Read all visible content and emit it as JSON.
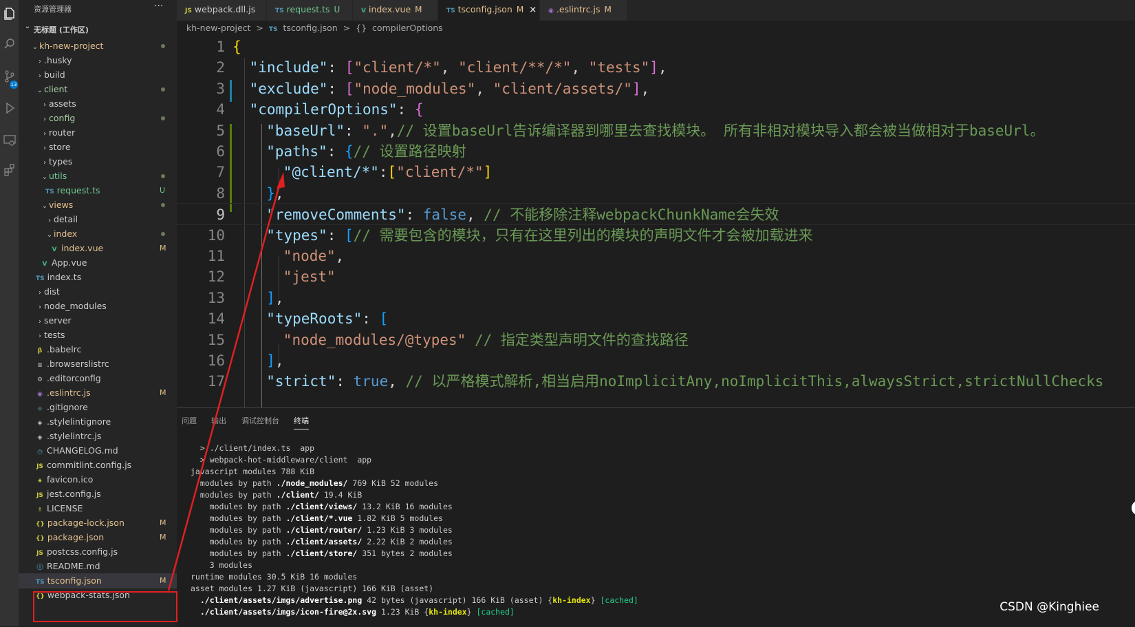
{
  "sidebar": {
    "header": "资源管理器",
    "more_label": "···",
    "workspace": "无标题 (工作区)",
    "items": [
      {
        "label": "kh-new-project",
        "depth": 0,
        "kind": "folder-open",
        "color": "#e2c08d",
        "status": "dot"
      },
      {
        "label": ".husky",
        "depth": 1,
        "kind": "folder",
        "color": "#cccccc",
        "status": ""
      },
      {
        "label": "build",
        "depth": 1,
        "kind": "folder",
        "color": "#cccccc",
        "status": ""
      },
      {
        "label": "client",
        "depth": 1,
        "kind": "folder-open",
        "color": "#a6cfa0",
        "status": "dot"
      },
      {
        "label": "assets",
        "depth": 2,
        "kind": "folder",
        "color": "#cccccc",
        "status": ""
      },
      {
        "label": "config",
        "depth": 2,
        "kind": "folder",
        "color": "#a6cfa0",
        "status": "dot"
      },
      {
        "label": "router",
        "depth": 2,
        "kind": "folder",
        "color": "#cccccc",
        "status": ""
      },
      {
        "label": "store",
        "depth": 2,
        "kind": "folder",
        "color": "#cccccc",
        "status": ""
      },
      {
        "label": "types",
        "depth": 2,
        "kind": "folder",
        "color": "#cccccc",
        "status": ""
      },
      {
        "label": "utils",
        "depth": 2,
        "kind": "folder-open",
        "color": "#73c991",
        "status": "dot"
      },
      {
        "label": "request.ts",
        "depth": 3,
        "kind": "ts",
        "color": "#73c991",
        "status": "U"
      },
      {
        "label": "views",
        "depth": 2,
        "kind": "folder-open",
        "color": "#e2c08d",
        "status": "dot"
      },
      {
        "label": "detail",
        "depth": 3,
        "kind": "folder",
        "color": "#cccccc",
        "status": ""
      },
      {
        "label": "index",
        "depth": 3,
        "kind": "folder-open",
        "color": "#e2c08d",
        "status": "dot"
      },
      {
        "label": "index.vue",
        "depth": 4,
        "kind": "vue",
        "color": "#e2c08d",
        "status": "M"
      },
      {
        "label": "App.vue",
        "depth": 2,
        "kind": "vue",
        "color": "#cccccc",
        "status": ""
      },
      {
        "label": "index.ts",
        "depth": 1,
        "kind": "ts",
        "color": "#cccccc",
        "status": ""
      },
      {
        "label": "dist",
        "depth": 1,
        "kind": "folder",
        "color": "#cccccc",
        "status": ""
      },
      {
        "label": "node_modules",
        "depth": 1,
        "kind": "folder",
        "color": "#cccccc",
        "status": ""
      },
      {
        "label": "server",
        "depth": 1,
        "kind": "folder",
        "color": "#cccccc",
        "status": ""
      },
      {
        "label": "tests",
        "depth": 1,
        "kind": "folder",
        "color": "#cccccc",
        "status": ""
      },
      {
        "label": ".babelrc",
        "depth": 1,
        "kind": "babel",
        "color": "#cccccc",
        "status": ""
      },
      {
        "label": ".browserslistrc",
        "depth": 1,
        "kind": "lines",
        "color": "#cccccc",
        "status": ""
      },
      {
        "label": ".editorconfig",
        "depth": 1,
        "kind": "gear",
        "color": "#cccccc",
        "status": ""
      },
      {
        "label": ".eslintrc.js",
        "depth": 1,
        "kind": "eslint",
        "color": "#e2c08d",
        "status": "M"
      },
      {
        "label": ".gitignore",
        "depth": 1,
        "kind": "git",
        "color": "#cccccc",
        "status": ""
      },
      {
        "label": ".stylelintignore",
        "depth": 1,
        "kind": "stylelint",
        "color": "#cccccc",
        "status": ""
      },
      {
        "label": ".stylelintrc.js",
        "depth": 1,
        "kind": "stylelint",
        "color": "#cccccc",
        "status": ""
      },
      {
        "label": "CHANGELOG.md",
        "depth": 1,
        "kind": "clock",
        "color": "#cccccc",
        "status": ""
      },
      {
        "label": "commitlint.config.js",
        "depth": 1,
        "kind": "js",
        "color": "#cccccc",
        "status": ""
      },
      {
        "label": "favicon.ico",
        "depth": 1,
        "kind": "star",
        "color": "#cccccc",
        "status": ""
      },
      {
        "label": "jest.config.js",
        "depth": 1,
        "kind": "js",
        "color": "#cccccc",
        "status": ""
      },
      {
        "label": "LICENSE",
        "depth": 1,
        "kind": "license",
        "color": "#cccccc",
        "status": ""
      },
      {
        "label": "package-lock.json",
        "depth": 1,
        "kind": "json",
        "color": "#e2c08d",
        "status": "M"
      },
      {
        "label": "package.json",
        "depth": 1,
        "kind": "json",
        "color": "#e2c08d",
        "status": "M"
      },
      {
        "label": "postcss.config.js",
        "depth": 1,
        "kind": "js",
        "color": "#cccccc",
        "status": ""
      },
      {
        "label": "README.md",
        "depth": 1,
        "kind": "info",
        "color": "#cccccc",
        "status": ""
      },
      {
        "label": "tsconfig.json",
        "depth": 1,
        "kind": "tsjson",
        "color": "#e2c08d",
        "status": "M",
        "selected": true
      },
      {
        "label": "webpack-stats.json",
        "depth": 1,
        "kind": "json",
        "color": "#cccccc",
        "status": ""
      }
    ]
  },
  "activity_bar": {
    "icons": [
      "files-icon",
      "search-icon",
      "source-control-icon",
      "run-debug-icon",
      "remote-explorer-icon",
      "extensions-icon"
    ],
    "badge": "13"
  },
  "tabs": [
    {
      "icon": "JS",
      "icon_color": "#cbcb41",
      "label": "webpack.dll.js",
      "label_color": "#cccccc",
      "status": "",
      "active": false
    },
    {
      "icon": "TS",
      "icon_color": "#519aba",
      "label": "request.ts",
      "label_color": "#73c991",
      "status": "U",
      "active": false
    },
    {
      "icon": "V",
      "icon_color": "#41b883",
      "label": "index.vue",
      "label_color": "#e2c08d",
      "status": "M",
      "active": false
    },
    {
      "icon": "TS",
      "icon_color": "#519aba",
      "label": "tsconfig.json",
      "label_color": "#e2c08d",
      "status": "M",
      "active": true,
      "close": "×"
    },
    {
      "icon": "◉",
      "icon_color": "#a074c4",
      "label": ".eslintrc.js",
      "label_color": "#e2c08d",
      "status": "M",
      "active": false
    }
  ],
  "breadcrumbs": {
    "project": "kh-new-project",
    "sep": ">",
    "file": "tsconfig.json",
    "file_icon": "TS",
    "symbol_icon": "{}",
    "symbol": "compilerOptions"
  },
  "editor": {
    "current_line": 9,
    "lines": [
      {
        "n": "1",
        "indent": 0,
        "tokens": [
          [
            "br1",
            "{"
          ]
        ]
      },
      {
        "n": "2",
        "indent": 1,
        "tokens": [
          [
            "k",
            "\"include\""
          ],
          [
            "p",
            ": "
          ],
          [
            "br2",
            "["
          ],
          [
            "s",
            "\"client/*\""
          ],
          [
            "p",
            ", "
          ],
          [
            "s",
            "\"client/**/*\""
          ],
          [
            "p",
            ", "
          ],
          [
            "s",
            "\"tests\""
          ],
          [
            "br2",
            "]"
          ],
          [
            "p",
            ","
          ]
        ]
      },
      {
        "n": "3",
        "indent": 1,
        "tokens": [
          [
            "k",
            "\"exclude\""
          ],
          [
            "p",
            ": "
          ],
          [
            "br2",
            "["
          ],
          [
            "s",
            "\"node_modules\""
          ],
          [
            "p",
            ", "
          ],
          [
            "s",
            "\"client/assets/\""
          ],
          [
            "br2",
            "]"
          ],
          [
            "p",
            ","
          ]
        ]
      },
      {
        "n": "4",
        "indent": 1,
        "tokens": [
          [
            "k",
            "\"compilerOptions\""
          ],
          [
            "p",
            ": "
          ],
          [
            "br2",
            "{"
          ]
        ]
      },
      {
        "n": "5",
        "indent": 2,
        "tokens": [
          [
            "k",
            "\"baseUrl\""
          ],
          [
            "p",
            ": "
          ],
          [
            "s",
            "\".\""
          ],
          [
            "p",
            ","
          ],
          [
            "c",
            "// 设置baseUrl告诉编译器到哪里去查找模块。 所有非相对模块导入都会被当做相对于baseUrl。"
          ]
        ]
      },
      {
        "n": "6",
        "indent": 2,
        "tokens": [
          [
            "k",
            "\"paths\""
          ],
          [
            "p",
            ": "
          ],
          [
            "br3",
            "{"
          ],
          [
            "c",
            "// 设置路径映射"
          ]
        ]
      },
      {
        "n": "7",
        "indent": 3,
        "tokens": [
          [
            "k",
            "\"@client/*\""
          ],
          [
            "p",
            ":"
          ],
          [
            "br1",
            "["
          ],
          [
            "s",
            "\"client/*\""
          ],
          [
            "br1",
            "]"
          ]
        ]
      },
      {
        "n": "8",
        "indent": 2,
        "tokens": [
          [
            "br3",
            "}"
          ],
          [
            "p",
            ","
          ]
        ]
      },
      {
        "n": "9",
        "indent": 2,
        "tokens": [
          [
            "k",
            "\"removeComments\""
          ],
          [
            "p",
            ": "
          ],
          [
            "b",
            "false"
          ],
          [
            "p",
            ", "
          ],
          [
            "c",
            "// 不能移除注释webpackChunkName会失效"
          ]
        ]
      },
      {
        "n": "10",
        "indent": 2,
        "tokens": [
          [
            "k",
            "\"types\""
          ],
          [
            "p",
            ": "
          ],
          [
            "br3",
            "["
          ],
          [
            "c",
            "// 需要包含的模块，只有在这里列出的模块的声明文件才会被加载进来"
          ]
        ]
      },
      {
        "n": "11",
        "indent": 3,
        "tokens": [
          [
            "s",
            "\"node\""
          ],
          [
            "p",
            ","
          ]
        ]
      },
      {
        "n": "12",
        "indent": 3,
        "tokens": [
          [
            "s",
            "\"jest\""
          ]
        ]
      },
      {
        "n": "13",
        "indent": 2,
        "tokens": [
          [
            "br3",
            "]"
          ],
          [
            "p",
            ","
          ]
        ]
      },
      {
        "n": "14",
        "indent": 2,
        "tokens": [
          [
            "k",
            "\"typeRoots\""
          ],
          [
            "p",
            ": "
          ],
          [
            "br3",
            "["
          ]
        ]
      },
      {
        "n": "15",
        "indent": 3,
        "tokens": [
          [
            "s",
            "\"node_modules/@types\""
          ],
          [
            "p",
            " "
          ],
          [
            "c",
            "// 指定类型声明文件的查找路径"
          ]
        ]
      },
      {
        "n": "16",
        "indent": 2,
        "tokens": [
          [
            "br3",
            "]"
          ],
          [
            "p",
            ","
          ]
        ]
      },
      {
        "n": "17",
        "indent": 2,
        "tokens": [
          [
            "k",
            "\"strict\""
          ],
          [
            "p",
            ": "
          ],
          [
            "b",
            "true"
          ],
          [
            "p",
            ", "
          ],
          [
            "c",
            "// 以严格模式解析,相当启用noImplicitAny,noImplicitThis,alwaysStrict,strictNullChecks"
          ]
        ]
      }
    ]
  },
  "panel": {
    "tabs": [
      "问题",
      "输出",
      "调试控制台",
      "终端"
    ],
    "active_tab": "终端",
    "terminal_lines": [
      [
        [
          "",
          "  > ./client/index.ts  app"
        ]
      ],
      [
        [
          "",
          "  > webpack-hot-middleware/client  app"
        ]
      ],
      [
        [
          "",
          "javascript modules 788 KiB"
        ]
      ],
      [
        [
          "",
          "  modules by path "
        ],
        [
          "tb",
          "./node_modules/"
        ],
        [
          "",
          " 769 KiB 52 modules"
        ]
      ],
      [
        [
          "",
          "  modules by path "
        ],
        [
          "tb",
          "./client/"
        ],
        [
          "",
          " 19.4 KiB"
        ]
      ],
      [
        [
          "",
          "    modules by path "
        ],
        [
          "tb",
          "./client/views/"
        ],
        [
          "",
          " 13.2 KiB 16 modules"
        ]
      ],
      [
        [
          "",
          "    modules by path "
        ],
        [
          "tb",
          "./client/*.vue"
        ],
        [
          "",
          " 1.82 KiB 5 modules"
        ]
      ],
      [
        [
          "",
          "    modules by path "
        ],
        [
          "tb",
          "./client/router/"
        ],
        [
          "",
          " 1.23 KiB 3 modules"
        ]
      ],
      [
        [
          "",
          "    modules by path "
        ],
        [
          "tb",
          "./client/assets/"
        ],
        [
          "",
          " 2.22 KiB 2 modules"
        ]
      ],
      [
        [
          "",
          "    modules by path "
        ],
        [
          "tb",
          "./client/store/"
        ],
        [
          "",
          " 351 bytes 2 modules"
        ]
      ],
      [
        [
          "",
          "    3 modules"
        ]
      ],
      [
        [
          "",
          "runtime modules 30.5 KiB 16 modules"
        ]
      ],
      [
        [
          "",
          "asset modules 1.27 KiB (javascript) 166 KiB (asset)"
        ]
      ],
      [
        [
          "",
          "  "
        ],
        [
          "tb",
          "./client/assets/imgs/advertise.png"
        ],
        [
          "",
          " 42 bytes (javascript) 166 KiB (asset) {"
        ],
        [
          "ty",
          "kh-index"
        ],
        [
          "",
          "} "
        ],
        [
          "tg",
          "[cached]"
        ]
      ],
      [
        [
          "",
          "  "
        ],
        [
          "tb",
          "./client/assets/imgs/icon-fire@2x.svg"
        ],
        [
          "",
          " 1.23 KiB {"
        ],
        [
          "ty",
          "kh-index"
        ],
        [
          "",
          "} "
        ],
        [
          "tg",
          "[cached]"
        ]
      ]
    ]
  },
  "watermark": "CSDN @Kinghiee"
}
